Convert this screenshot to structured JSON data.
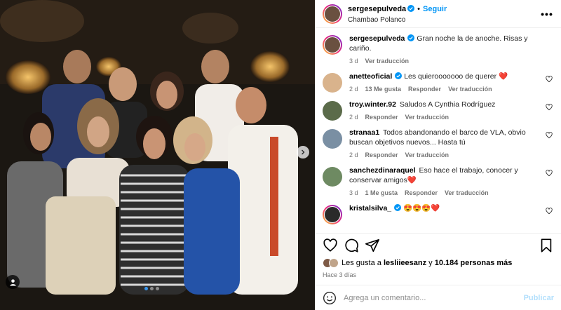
{
  "post": {
    "author": "sergesepulveda",
    "follow_label": "Seguir",
    "location": "Chambao Polanco",
    "more_label": "•••"
  },
  "caption": {
    "user": "sergesepulveda",
    "text": "Gran noche la de anoche. Risas y cariño.",
    "time": "3 d",
    "translate": "Ver traducción"
  },
  "comments": [
    {
      "user": "anetteoficial",
      "verified": true,
      "text": "Les quierooooooo de querer ❤️",
      "time": "2 d",
      "likes": "13 Me gusta",
      "reply": "Responder",
      "translate": "Ver traducción",
      "avatar_color": "#d9b38c"
    },
    {
      "user": "troy.winter.92",
      "verified": false,
      "text": "Saludos A Cynthia Rodríguez",
      "time": "2 d",
      "likes": "",
      "reply": "Responder",
      "translate": "Ver traducción",
      "avatar_color": "#5b6b4a"
    },
    {
      "user": "stranaa1",
      "verified": false,
      "text": "Todos abandonando el barco de VLA, obvio buscan objetivos nuevos... Hasta tú",
      "time": "2 d",
      "likes": "",
      "reply": "Responder",
      "translate": "Ver traducción",
      "avatar_color": "#7a8fa3"
    },
    {
      "user": "sanchezdinaraquel",
      "verified": false,
      "text": "Eso hace el trabajo, conocer y conservar amigos❤️",
      "time": "3 d",
      "likes": "1 Me gusta",
      "reply": "Responder",
      "translate": "Ver traducción",
      "avatar_color": "#6e8a62"
    },
    {
      "user": "kristalsilva_",
      "verified": true,
      "text": "😍😍😍❤️",
      "time": "",
      "likes": "",
      "reply": "",
      "translate": "",
      "avatar_color": "#2a2a2a"
    }
  ],
  "likes": {
    "prefix": "Les gusta a ",
    "user": "lesliieesanz",
    "middle": " y ",
    "count": "10.184 personas más"
  },
  "posted_ago": "Hace 3 días",
  "compose": {
    "placeholder": "Agrega un comentario...",
    "publish_label": "Publicar"
  },
  "colors": {
    "accent": "#0095f6",
    "verified": "#0095f6",
    "heart": "#ed4956"
  },
  "icons": {
    "like": "heart-icon",
    "comment": "comment-icon",
    "share": "share-icon",
    "save": "bookmark-icon",
    "emoji": "emoji-icon",
    "more": "more-icon",
    "next": "chevron-right-icon",
    "tag": "user-tag-icon"
  }
}
